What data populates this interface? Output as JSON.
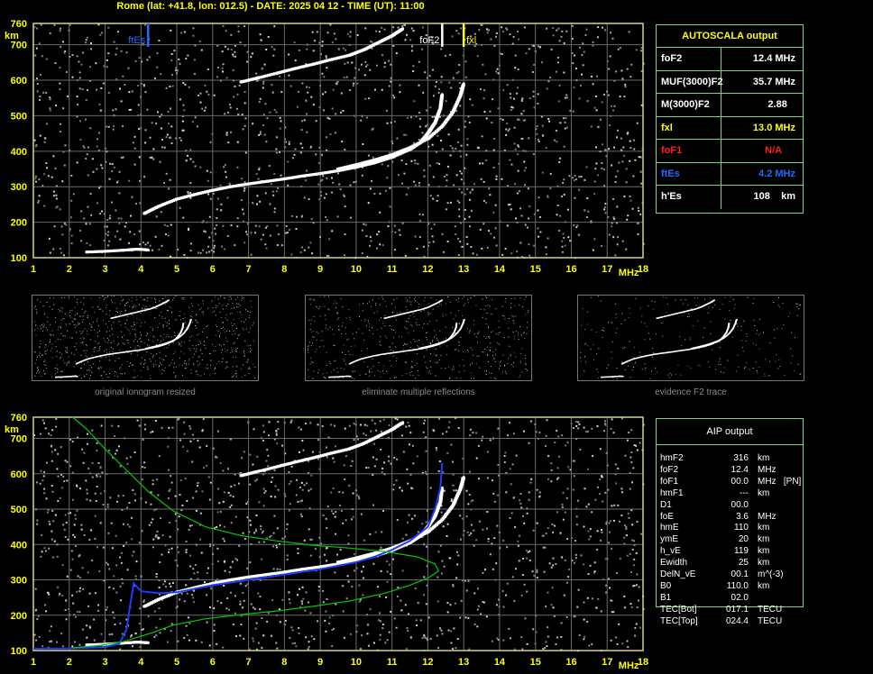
{
  "header": {
    "title": "Rome (lat: +41.8, lon: 012.5) - DATE: 2025 04 12 - TIME (UT): 11:00"
  },
  "axes": {
    "y_unit": "km",
    "x_unit": "MHz",
    "y_ticks": [
      100,
      200,
      300,
      400,
      500,
      600,
      700,
      760
    ],
    "x_ticks": [
      1,
      2,
      3,
      4,
      5,
      6,
      7,
      8,
      9,
      10,
      11,
      12,
      13,
      14,
      15,
      16,
      17,
      18
    ],
    "xlim": [
      1,
      18
    ],
    "ylim": [
      100,
      760
    ],
    "grid": true
  },
  "markers": {
    "ftEs": {
      "label": "ftEs",
      "freq": 4.2,
      "color": "#1e6cff"
    },
    "foF2": {
      "label": "foF2",
      "freq": 12.4,
      "color": "#ffffff"
    },
    "fxl": {
      "label": "fxl",
      "freq": 13.0,
      "color": "#ffff00"
    }
  },
  "autoscala": {
    "title": "AUTOSCALA output",
    "rows": [
      {
        "key": "foF2",
        "value": "12.4 MHz",
        "color": "#ffffff"
      },
      {
        "key": "MUF(3000)F2",
        "value": "35.7 MHz",
        "color": "#ffffff"
      },
      {
        "key": "M(3000)F2",
        "value": "2.88   ",
        "color": "#ffffff"
      },
      {
        "key": "fxl",
        "value": "13.0 MHz",
        "color": "#ffff00"
      },
      {
        "key": "foF1",
        "value": "N/A     ",
        "color": "#ff2020"
      },
      {
        "key": "ftEs",
        "value": "4.2 MHz",
        "color": "#1e6cff"
      },
      {
        "key": "h'Es",
        "value": "108    km",
        "color": "#ffffff"
      }
    ]
  },
  "thumbnails": [
    {
      "caption": "original ionogram resized"
    },
    {
      "caption": "eliminate multiple reflections"
    },
    {
      "caption": "evidence F2 trace"
    }
  ],
  "aip": {
    "title": "AIP output",
    "rows": [
      {
        "key": "hmF2",
        "value": "316",
        "unit": "km"
      },
      {
        "key": "foF2",
        "value": "12.4",
        "unit": "MHz"
      },
      {
        "key": "foF1",
        "value": "00.0",
        "unit": "MHz   [PN]"
      },
      {
        "key": "hmF1",
        "value": "---",
        "unit": "km"
      },
      {
        "key": "D1",
        "value": "00.0",
        "unit": ""
      },
      {
        "key": "foE",
        "value": "3.6",
        "unit": "MHz"
      },
      {
        "key": "hmE",
        "value": "110",
        "unit": "km"
      },
      {
        "key": "ymE",
        "value": "20",
        "unit": "km"
      },
      {
        "key": "h_vE",
        "value": "119",
        "unit": "km"
      },
      {
        "key": "Ewidth",
        "value": "25",
        "unit": "km"
      },
      {
        "key": "DelN_vE",
        "value": "00.1",
        "unit": "m^(-3)"
      },
      {
        "key": "B0",
        "value": "110.0",
        "unit": "km"
      },
      {
        "key": "B1",
        "value": "02.0",
        "unit": ""
      },
      {
        "key": "TEC[Bot]",
        "value": "017.1",
        "unit": "TECU"
      },
      {
        "key": "TEC[Top]",
        "value": "024.4",
        "unit": "TECU"
      }
    ]
  },
  "chart_data": [
    {
      "type": "scatter",
      "title": "",
      "xlabel": "MHz",
      "ylabel": "km",
      "xlim": [
        1,
        18
      ],
      "ylim": [
        100,
        760
      ],
      "series": [
        {
          "name": "",
          "color": "#ffffff",
          "x": [
            2.5,
            3.0,
            3.5,
            3.9,
            4.2
          ],
          "y": [
            116,
            118,
            121,
            124,
            122
          ]
        },
        {
          "name": "",
          "color": "#ffffff",
          "x": [
            4.1,
            4.5,
            5.0,
            5.5,
            6.0,
            6.5,
            7.0,
            7.5,
            8.0,
            8.5,
            9.0,
            9.5,
            10.0,
            10.5,
            11.0,
            11.5,
            11.8,
            12.0,
            12.2,
            12.35,
            12.4
          ],
          "y": [
            225,
            245,
            265,
            278,
            290,
            300,
            308,
            315,
            322,
            330,
            337,
            345,
            355,
            367,
            383,
            405,
            425,
            450,
            480,
            520,
            560
          ]
        },
        {
          "name": "",
          "color": "#ffffff",
          "x": [
            9.5,
            10.0,
            10.5,
            11.0,
            11.5,
            12.0,
            12.4,
            12.7,
            12.9,
            13.0
          ],
          "y": [
            350,
            362,
            375,
            390,
            410,
            435,
            470,
            510,
            555,
            590
          ]
        },
        {
          "name": "",
          "color": "#ffffff",
          "x": [
            6.8,
            7.2,
            7.8,
            8.3,
            8.8,
            9.3,
            9.8,
            10.2,
            10.6,
            11.0,
            11.3
          ],
          "y": [
            595,
            605,
            620,
            633,
            645,
            658,
            670,
            685,
            705,
            725,
            745
          ]
        }
      ]
    },
    {
      "type": "line",
      "title": "",
      "xlabel": "MHz",
      "ylabel": "km",
      "xlim": [
        1,
        18
      ],
      "ylim": [
        100,
        760
      ],
      "series": [
        {
          "name": "",
          "color": "#ffffff",
          "x": [
            2.5,
            3.0,
            3.5,
            3.9,
            4.2
          ],
          "y": [
            116,
            118,
            121,
            124,
            122
          ]
        },
        {
          "name": "",
          "color": "#ffffff",
          "x": [
            4.1,
            4.5,
            5.0,
            5.5,
            6.0,
            6.5,
            7.0,
            7.5,
            8.0,
            8.5,
            9.0,
            9.5,
            10.0,
            10.5,
            11.0,
            11.5,
            11.8,
            12.0,
            12.2,
            12.35,
            12.4
          ],
          "y": [
            225,
            245,
            265,
            278,
            290,
            300,
            308,
            315,
            322,
            330,
            337,
            345,
            355,
            367,
            383,
            405,
            425,
            450,
            480,
            520,
            560
          ]
        },
        {
          "name": "",
          "color": "#ffffff",
          "x": [
            9.5,
            10.0,
            10.5,
            11.0,
            11.5,
            12.0,
            12.4,
            12.7,
            12.9,
            13.0
          ],
          "y": [
            350,
            362,
            375,
            390,
            410,
            435,
            470,
            510,
            555,
            590
          ]
        },
        {
          "name": "",
          "color": "#ffffff",
          "x": [
            6.8,
            7.2,
            7.8,
            8.3,
            8.8,
            9.3,
            9.8,
            10.2,
            10.6,
            11.0,
            11.3
          ],
          "y": [
            595,
            605,
            620,
            633,
            645,
            658,
            670,
            685,
            705,
            725,
            745
          ]
        },
        {
          "name": "",
          "color": "#1e3cff",
          "x": [
            1.0,
            2.0,
            3.0,
            3.4,
            3.6,
            3.7,
            3.8,
            4.0,
            4.5,
            5.0,
            6.0,
            7.0,
            8.0,
            9.0,
            10.0,
            10.5,
            11.0,
            11.5,
            12.0,
            12.2,
            12.35,
            12.4
          ],
          "y": [
            105,
            106,
            110,
            120,
            160,
            230,
            290,
            268,
            262,
            265,
            285,
            300,
            315,
            330,
            350,
            365,
            385,
            410,
            450,
            500,
            560,
            630
          ]
        },
        {
          "name": "",
          "color": "#00c800",
          "x": [
            2.1,
            2.8,
            3.5,
            4.3,
            4.9,
            5.8,
            6.8,
            7.8,
            8.8,
            9.8,
            10.8,
            11.5,
            12.0,
            12.3,
            12.2,
            11.7,
            10.8,
            9.8,
            8.8,
            7.8,
            6.8,
            5.8,
            4.9,
            4.2,
            3.6,
            3.0,
            2.5,
            2.1
          ],
          "y": [
            108,
            114,
            125,
            150,
            172,
            190,
            202,
            212,
            225,
            240,
            262,
            285,
            305,
            325,
            345,
            365,
            380,
            390,
            398,
            410,
            425,
            450,
            495,
            550,
            610,
            670,
            725,
            760
          ]
        }
      ]
    }
  ]
}
